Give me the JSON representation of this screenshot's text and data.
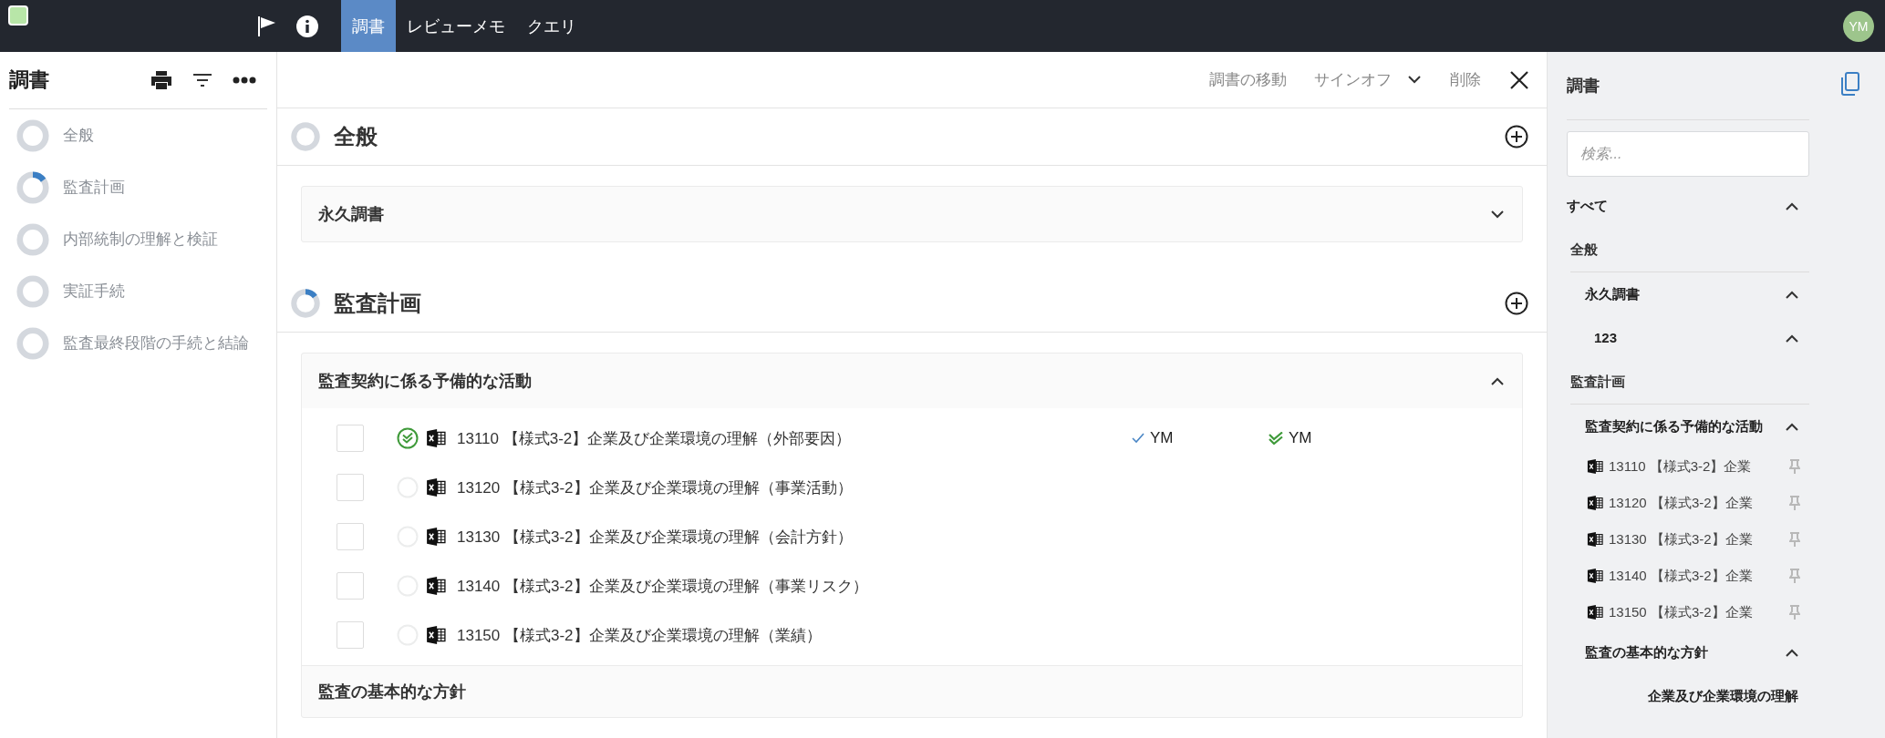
{
  "topbar": {
    "tabs": [
      {
        "label": "調書",
        "selected": true
      },
      {
        "label": "レビューメモ",
        "selected": false
      },
      {
        "label": "クエリ",
        "selected": false
      }
    ],
    "avatar": "YM"
  },
  "left": {
    "title": "調書",
    "items": [
      {
        "label": "全般",
        "level": 0
      },
      {
        "label": "監査計画",
        "level": 0.15
      },
      {
        "label": "内部統制の理解と検証",
        "level": 0
      },
      {
        "label": "実証手続",
        "level": 0
      },
      {
        "label": "監査最終段階の手続と結論",
        "level": 0
      }
    ]
  },
  "toolbar": {
    "actions": [
      {
        "label": "調書の移動",
        "kind": "plain"
      },
      {
        "label": "サインオフ",
        "kind": "dropdown"
      },
      {
        "label": "削除",
        "kind": "plain"
      }
    ]
  },
  "sections": [
    {
      "title": "全般",
      "level": 0,
      "cards": [
        {
          "title": "永久調書",
          "expanded": false
        }
      ]
    },
    {
      "title": "監査計画",
      "level": 0.15,
      "cards": [
        {
          "title": "監査契約に係る予備的な活動",
          "expanded": true,
          "rows": [
            {
              "label": "13110 【様式3-2】企業及び企業環境の理解（外部要因）",
              "checked": false,
              "completed": true,
              "preparer": "YM",
              "reviewer": "YM"
            },
            {
              "label": "13120 【様式3-2】企業及び企業環境の理解（事業活動）",
              "checked": false,
              "completed": false
            },
            {
              "label": "13130 【様式3-2】企業及び企業環境の理解（会計方針）",
              "checked": false,
              "completed": false
            },
            {
              "label": "13140 【様式3-2】企業及び企業環境の理解（事業リスク）",
              "checked": false,
              "completed": false
            },
            {
              "label": "13150 【様式3-2】企業及び企業環境の理解（業績）",
              "checked": false,
              "completed": false
            }
          ]
        }
      ],
      "next_heading": "監査の基本的な方針"
    }
  ],
  "right": {
    "title": "調書",
    "search": {
      "placeholder": "検索..."
    },
    "tree": [
      {
        "kind": "group",
        "label": "すべて",
        "expanded": true,
        "children": [
          {
            "kind": "heading",
            "label": "全般",
            "children": [
              {
                "kind": "group",
                "label": "永久調書",
                "expanded": true,
                "children": [
                  {
                    "kind": "group",
                    "label": "123",
                    "expanded": true
                  }
                ]
              }
            ]
          },
          {
            "kind": "heading",
            "label": "監査計画",
            "children": [
              {
                "kind": "group",
                "label": "監査契約に係る予備的な活動",
                "expanded": true,
                "children": [
                  {
                    "kind": "file",
                    "label": "13110 【様式3-2】企業"
                  },
                  {
                    "kind": "file",
                    "label": "13120 【様式3-2】企業"
                  },
                  {
                    "kind": "file",
                    "label": "13130 【様式3-2】企業"
                  },
                  {
                    "kind": "file",
                    "label": "13140 【様式3-2】企業"
                  },
                  {
                    "kind": "file",
                    "label": "13150 【様式3-2】企業"
                  }
                ]
              },
              {
                "kind": "group",
                "label": "監査の基本的な方針",
                "expanded": true,
                "children": [
                  {
                    "kind": "group",
                    "label": "企業及び企業環境の理解"
                  }
                ]
              }
            ]
          }
        ]
      }
    ]
  }
}
